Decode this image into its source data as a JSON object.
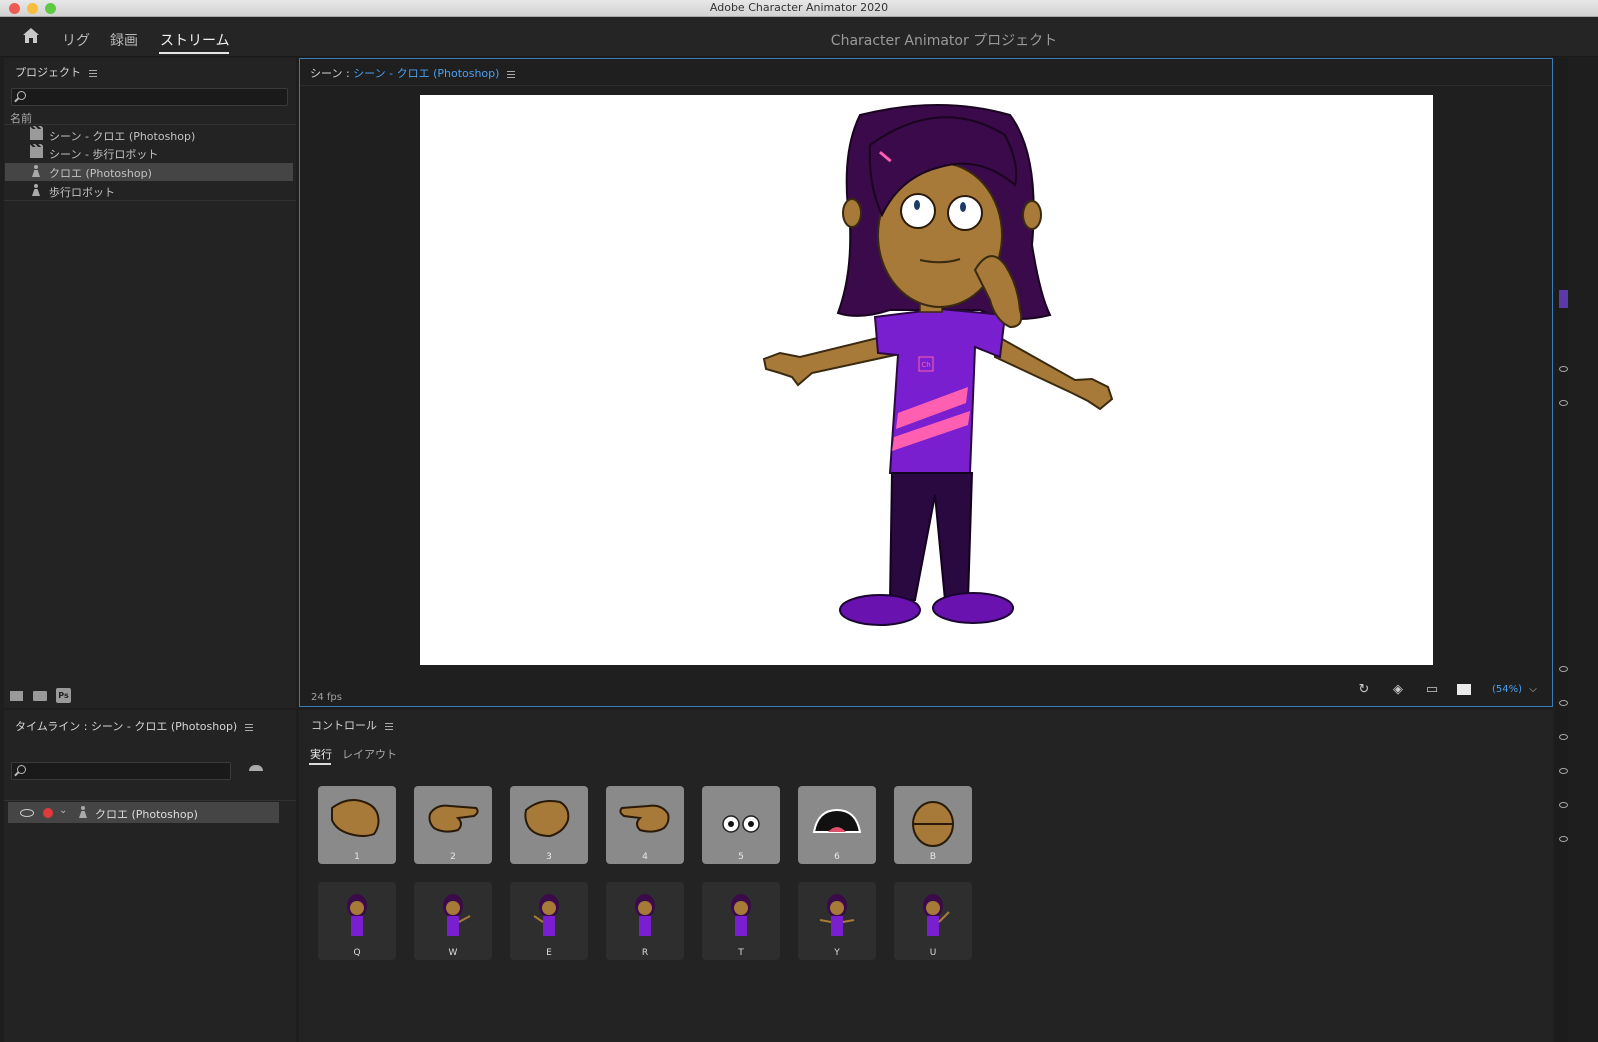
{
  "window": {
    "title": "Adobe Character Animator 2020"
  },
  "workspace": {
    "tabs": [
      {
        "label": "リグ"
      },
      {
        "label": "録画"
      },
      {
        "label": "ストリーム"
      }
    ],
    "active_tab": "ストリーム",
    "project_title": "Character Animator プロジェクト"
  },
  "project_panel": {
    "title": "プロジェクト",
    "column_header": "名前",
    "items": [
      {
        "label": "シーン - クロエ (Photoshop)",
        "icon": "scene-icon"
      },
      {
        "label": "シーン - 歩行ロボット",
        "icon": "scene-icon"
      },
      {
        "label": "クロエ (Photoshop)",
        "icon": "puppet-icon",
        "selected": true
      },
      {
        "label": "歩行ロボット",
        "icon": "puppet-icon"
      }
    ],
    "footer_ps": "Ps"
  },
  "scene_panel": {
    "prefix": "シーン :",
    "scene_name": "シーン - クロエ (Photoshop)",
    "fps": "24 fps",
    "zoom": "(54%)",
    "puppet_shirt_logo": "Ch"
  },
  "timeline_panel": {
    "title": "タイムライン : シーン - クロエ (Photoshop)",
    "track_label": "クロエ (Photoshop)"
  },
  "controls_panel": {
    "title": "コントロール",
    "tabs": [
      {
        "label": "実行"
      },
      {
        "label": "レイアウト"
      }
    ],
    "row1": [
      {
        "key": "1",
        "icon": "hand-open-icon"
      },
      {
        "key": "2",
        "icon": "hand-point-icon"
      },
      {
        "key": "3",
        "icon": "hand-wave-icon"
      },
      {
        "key": "4",
        "icon": "hand-point-left-icon"
      },
      {
        "key": "5",
        "icon": "eyes-icon"
      },
      {
        "key": "6",
        "icon": "mouth-icon"
      },
      {
        "key": "B",
        "icon": "head-icon"
      }
    ],
    "row2": [
      {
        "key": "Q"
      },
      {
        "key": "W"
      },
      {
        "key": "E"
      },
      {
        "key": "R"
      },
      {
        "key": "T"
      },
      {
        "key": "Y"
      },
      {
        "key": "U"
      }
    ]
  },
  "colors": {
    "accent_blue": "#4aa0f0",
    "selection": "#454545",
    "record_red": "#e03a3a",
    "shirt_purple": "#7a1fd0",
    "skin": "#a87a3a",
    "hair": "#3a0a4a"
  }
}
